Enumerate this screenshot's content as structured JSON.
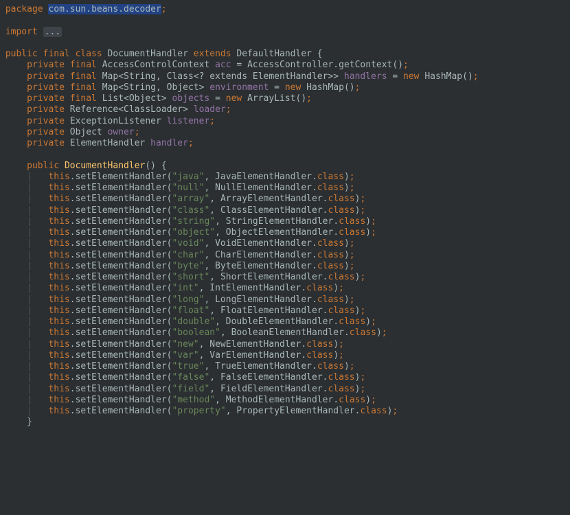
{
  "package_kw": "package",
  "package_name": "com.sun.beans.decoder",
  "import_kw": "import",
  "import_fold": "...",
  "class_decl": {
    "mods": "public final class",
    "name": "DocumentHandler",
    "extends_kw": "extends",
    "super": "DefaultHandler"
  },
  "fields": [
    {
      "mods": "private final",
      "type": "AccessControlContext",
      "name": "acc",
      "init_call": "AccessController.getContext()",
      "new": false
    },
    {
      "mods": "private final",
      "type": "Map<String, Class<? extends ElementHandler>>",
      "name": "handlers",
      "init_call": "HashMap()",
      "new": true
    },
    {
      "mods": "private final",
      "type": "Map<String, Object>",
      "name": "environment",
      "init_call": "HashMap()",
      "new": true
    },
    {
      "mods": "private final",
      "type": "List<Object>",
      "name": "objects",
      "init_call": "ArrayList()",
      "new": true
    },
    {
      "mods": "private",
      "type": "Reference<ClassLoader>",
      "name": "loader",
      "init_call": null,
      "new": false
    },
    {
      "mods": "private",
      "type": "ExceptionListener",
      "name": "listener",
      "init_call": null,
      "new": false
    },
    {
      "mods": "private",
      "type": "Object",
      "name": "owner",
      "init_call": null,
      "new": false
    },
    {
      "mods": "private",
      "type": "ElementHandler",
      "name": "handler",
      "init_call": null,
      "new": false
    }
  ],
  "ctor": {
    "mods": "public",
    "name": "DocumentHandler"
  },
  "method": "setElementHandler",
  "calls": [
    {
      "tag": "java",
      "cls": "JavaElementHandler"
    },
    {
      "tag": "null",
      "cls": "NullElementHandler"
    },
    {
      "tag": "array",
      "cls": "ArrayElementHandler"
    },
    {
      "tag": "class",
      "cls": "ClassElementHandler"
    },
    {
      "tag": "string",
      "cls": "StringElementHandler"
    },
    {
      "tag": "object",
      "cls": "ObjectElementHandler"
    },
    {
      "tag": "void",
      "cls": "VoidElementHandler"
    },
    {
      "tag": "char",
      "cls": "CharElementHandler"
    },
    {
      "tag": "byte",
      "cls": "ByteElementHandler"
    },
    {
      "tag": "short",
      "cls": "ShortElementHandler"
    },
    {
      "tag": "int",
      "cls": "IntElementHandler"
    },
    {
      "tag": "long",
      "cls": "LongElementHandler"
    },
    {
      "tag": "float",
      "cls": "FloatElementHandler"
    },
    {
      "tag": "double",
      "cls": "DoubleElementHandler"
    },
    {
      "tag": "boolean",
      "cls": "BooleanElementHandler"
    },
    {
      "tag": "new",
      "cls": "NewElementHandler"
    },
    {
      "tag": "var",
      "cls": "VarElementHandler"
    },
    {
      "tag": "true",
      "cls": "TrueElementHandler"
    },
    {
      "tag": "false",
      "cls": "FalseElementHandler"
    },
    {
      "tag": "field",
      "cls": "FieldElementHandler"
    },
    {
      "tag": "method",
      "cls": "MethodElementHandler"
    },
    {
      "tag": "property",
      "cls": "PropertyElementHandler"
    }
  ]
}
